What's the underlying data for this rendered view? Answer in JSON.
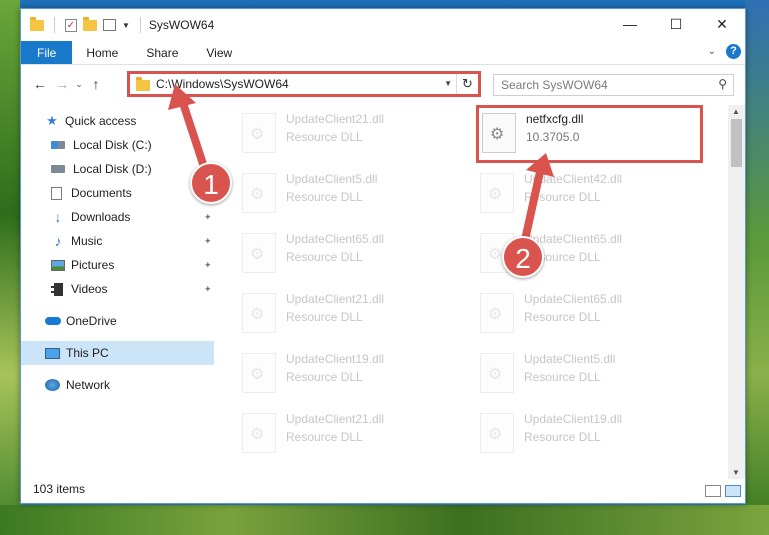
{
  "window": {
    "title": "SysWOW64",
    "minimize_glyph": "—",
    "maximize_glyph": "☐",
    "close_glyph": "✕"
  },
  "ribbon": {
    "tabs": [
      "File",
      "Home",
      "Share",
      "View"
    ],
    "help_glyph": "?",
    "expand_glyph": "⌄"
  },
  "navigation": {
    "back_glyph": "←",
    "forward_glyph": "→",
    "recent_glyph": "⌄",
    "up_glyph": "↑",
    "address": "C:\\Windows\\SysWOW64",
    "refresh_glyph": "↻",
    "search_placeholder": "Search SysWOW64",
    "search_glyph": "⚲"
  },
  "sidebar": {
    "items": [
      {
        "label": "Quick access",
        "icon": "star-icon"
      },
      {
        "label": "Local Disk (C:)",
        "icon": "drive-icon"
      },
      {
        "label": "Local Disk (D:)",
        "icon": "drive-icon"
      },
      {
        "label": "Documents",
        "icon": "documents-icon"
      },
      {
        "label": "Downloads",
        "icon": "downloads-icon"
      },
      {
        "label": "Music",
        "icon": "music-icon"
      },
      {
        "label": "Pictures",
        "icon": "pictures-icon"
      },
      {
        "label": "Videos",
        "icon": "videos-icon"
      },
      {
        "label": "OneDrive",
        "icon": "onedrive-icon"
      },
      {
        "label": "This PC",
        "icon": "computer-icon"
      },
      {
        "label": "Network",
        "icon": "network-icon"
      }
    ],
    "pin_glyph": "📌"
  },
  "files": {
    "left": [
      {
        "name": "UpdateClient21.dll",
        "desc": "Resource DLL"
      },
      {
        "name": "UpdateClient5.dll",
        "desc": "Resource DLL"
      },
      {
        "name": "UpdateClient65.dll",
        "desc": "Resource DLL"
      },
      {
        "name": "UpdateClient21.dll",
        "desc": "Resource DLL"
      },
      {
        "name": "UpdateClient19.dll",
        "desc": "Resource DLL"
      },
      {
        "name": "UpdateClient21.dll",
        "desc": "Resource DLL"
      }
    ],
    "right": [
      {
        "name": "netfxcfg.dll",
        "desc": "10.3705.0"
      },
      {
        "name": "UpdateClient42.dll",
        "desc": "Resource DLL"
      },
      {
        "name": "UpdateClient65.dll",
        "desc": "Resource DLL"
      },
      {
        "name": "UpdateClient65.dll",
        "desc": "Resource DLL"
      },
      {
        "name": "UpdateClient5.dll",
        "desc": "Resource DLL"
      },
      {
        "name": "UpdateClient19.dll",
        "desc": "Resource DLL"
      }
    ]
  },
  "status": {
    "item_count": "103 items"
  },
  "annotations": {
    "callout_1": "1",
    "callout_2": "2",
    "color": "#d9534f"
  }
}
